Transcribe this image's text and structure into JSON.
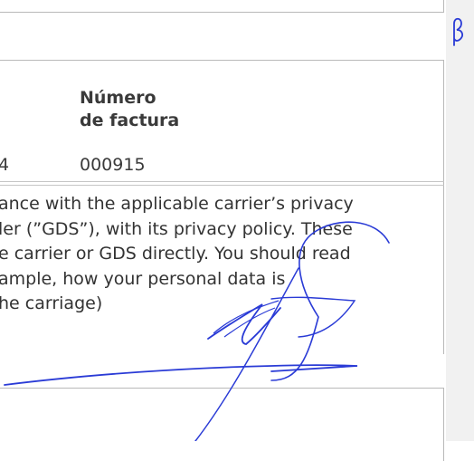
{
  "page": {
    "header_label_line1": "Número",
    "header_label_line2": "de factura",
    "row_left_value": "4",
    "invoice_number": "000915",
    "paragraph_lines": [
      "ance with the applicable carrier’s privacy",
      "ler (”GDS”), with its privacy policy. These",
      "e carrier or GDS directly. You should read",
      "ample, how your personal data is",
      "he carriage)"
    ],
    "margin_mark": "β"
  },
  "colors": {
    "text": "#333333",
    "rule": "#b9b9b9",
    "margin_bg": "#f1f1f1",
    "ink": "#2a3bd6"
  }
}
